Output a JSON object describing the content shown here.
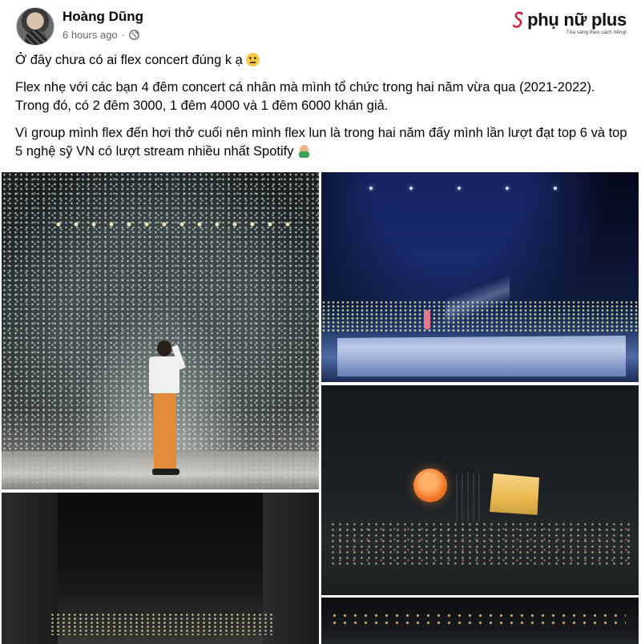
{
  "post": {
    "author": "Hoàng Dũng",
    "timestamp": "6 hours ago",
    "separator": "·",
    "privacy_icon": "globe-icon",
    "paragraphs": [
      "Ở đây chưa có ai flex concert đúng k ạ",
      "Flex nhẹ với các bạn 4 đêm concert cá nhân mà mình tổ chức trong hai năm vừa qua (2021-2022). Trong đó, có 2 đêm 3000, 1 đêm 4000 và 1 đêm 6000 khán giả.",
      "Vì group mình flex đến hơi thở cuối nên mình flex lun là trong hai năm đấy mình lần lượt đạt top 6 và top 5 nghệ sỹ VN có lượt stream nhiều nhất Spotify"
    ],
    "emojis": [
      "neutral-face-emoji",
      "person-phone-emoji"
    ]
  },
  "watermark": {
    "name": "phụ nữ plus",
    "tagline": "Tỏa sáng theo cách riêng!",
    "color": "#d31f3c"
  },
  "photos": [
    {
      "name": "confetti-stage-photo"
    },
    {
      "name": "blue-stage-photo"
    },
    {
      "name": "orange-moon-stage-photo"
    },
    {
      "name": "dark-hall-photo"
    },
    {
      "name": "crowd-lights-photo"
    }
  ],
  "colors": {
    "text": "#050505",
    "secondary_text": "#65676b",
    "background": "#ffffff"
  }
}
